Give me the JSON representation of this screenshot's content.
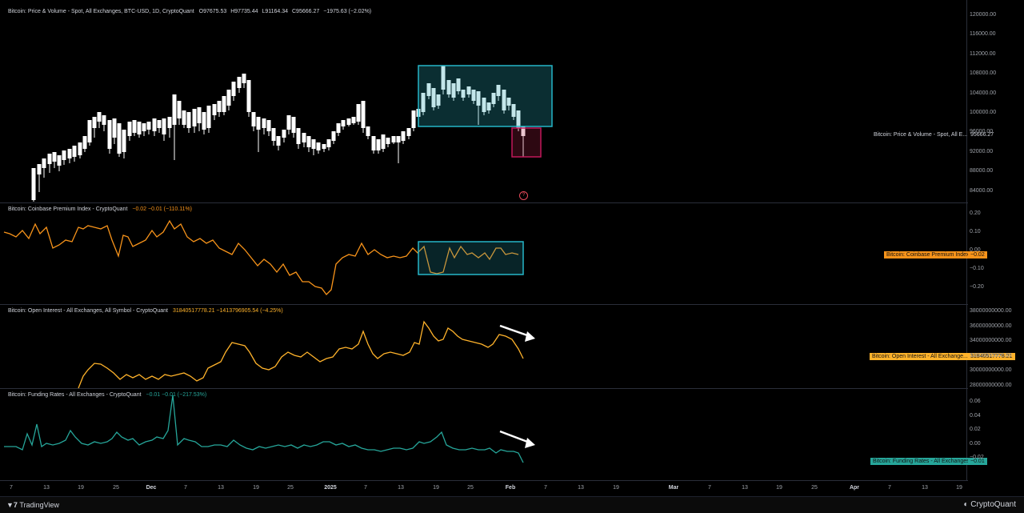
{
  "price_pane": {
    "title": "Bitcoin: Price & Volume - Spot, All Exchanges, BTC-USD, 1D, CryptoQuant",
    "ohlc": [
      {
        "k": "O",
        "v": "97675.53"
      },
      {
        "k": "H",
        "v": "97735.44"
      },
      {
        "k": "L",
        "v": "91164.34"
      },
      {
        "k": "C",
        "v": "95666.27"
      }
    ],
    "change": "−1975.63 (−2.02%)",
    "series_label": "Bitcoin: Price & Volume - Spot, All E...",
    "last_value": "95666.27",
    "y_ticks": [
      "120000.00",
      "116000.00",
      "112000.00",
      "108000.00",
      "104000.00",
      "100000.00",
      "96000.00",
      "92000.00",
      "88000.00",
      "84000.00"
    ],
    "marker": "?"
  },
  "premium_pane": {
    "title": "Bitcoin: Coinbase Premium Index - CryptoQuant",
    "values": "−0.02  −0.01 (−110.11%)",
    "tag_label": "Bitcoin: Coinbase Premium Index",
    "tag_value": "−0.02",
    "y_ticks": [
      "0.20",
      "0.10",
      "0.00",
      "−0.10",
      "−0.20"
    ],
    "color": "#f7931a"
  },
  "oi_pane": {
    "title": "Bitcoin: Open Interest - All Exchanges, All Symbol - CryptoQuant",
    "values": "31840517778.21  −1413796905.54 (−4.25%)",
    "tag_label": "Bitcoin: Open Interest - All Exchange...",
    "tag_value": "31840517778.21",
    "y_ticks": [
      "38000000000.00",
      "36000000000.00",
      "34000000000.00",
      "32000000000.00",
      "30000000000.00",
      "28000000000.00"
    ],
    "color": "#ffb32b"
  },
  "funding_pane": {
    "title": "Bitcoin: Funding Rates - All Exchanges - CryptoQuant",
    "values": "−0.01  −0.01 (−217.53%)",
    "tag_label": "Bitcoin: Funding Rates - All Exchanges",
    "tag_value": "−0.01",
    "y_ticks": [
      "0.06",
      "0.04",
      "0.02",
      "0.00",
      "−0.02"
    ],
    "color": "#26a69a"
  },
  "x_axis": [
    "7",
    "13",
    "19",
    "25",
    "Dec",
    "7",
    "13",
    "19",
    "25",
    "2025",
    "7",
    "13",
    "19",
    "25",
    "Feb",
    "7",
    "13",
    "19",
    "Mar",
    "7",
    "13",
    "19",
    "25",
    "Apr",
    "7",
    "13",
    "19"
  ],
  "footer": {
    "left": "TradingView",
    "right": "CryptoQuant"
  }
}
